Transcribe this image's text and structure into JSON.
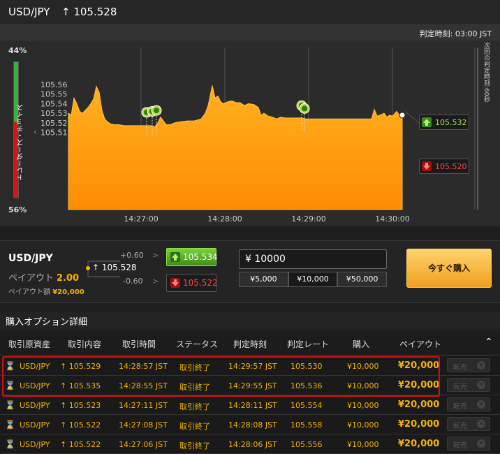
{
  "header": {
    "pair": "USD/JPY",
    "rate": "↑ 105.528"
  },
  "judge_bar": {
    "text": "判定時刻:  03:00 JST"
  },
  "sentiment": {
    "top_pct": "44%",
    "bottom_pct": "56%",
    "label": "トレーダーズ・チョイス",
    "up_fraction": 0.44
  },
  "next_judge": {
    "text": "次回の判定時刻:60秒"
  },
  "chart_data": {
    "type": "area",
    "y_ticks": [
      "105.56",
      "105.55",
      "105.54",
      "105.53",
      "105.52",
      "105.51"
    ],
    "ylim": [
      105.505,
      105.565
    ],
    "x_ticks": [
      "14:27:00",
      "14:28:00",
      "14:29:00",
      "14:30:00"
    ],
    "colors": {
      "fill_top": "#ffb020",
      "fill_bottom": "#ff8c00",
      "line": "#ffc040"
    },
    "points": [
      [
        0,
        105.53
      ],
      [
        4,
        105.528
      ],
      [
        8,
        105.546
      ],
      [
        12,
        105.54
      ],
      [
        16,
        105.532
      ],
      [
        20,
        105.53
      ],
      [
        24,
        105.533
      ],
      [
        28,
        105.536
      ],
      [
        32,
        105.54
      ],
      [
        36,
        105.545
      ],
      [
        40,
        105.558
      ],
      [
        44,
        105.552
      ],
      [
        48,
        105.533
      ],
      [
        52,
        105.524
      ],
      [
        56,
        105.521
      ],
      [
        60,
        105.519
      ],
      [
        66,
        105.518
      ],
      [
        72,
        105.518
      ],
      [
        80,
        105.517
      ],
      [
        90,
        105.517
      ],
      [
        100,
        105.517
      ],
      [
        110,
        105.517
      ],
      [
        118,
        105.517
      ],
      [
        124,
        105.516
      ],
      [
        128,
        105.52
      ],
      [
        132,
        105.526
      ],
      [
        136,
        105.522
      ],
      [
        140,
        105.518
      ],
      [
        146,
        105.518
      ],
      [
        152,
        105.52
      ],
      [
        160,
        105.521
      ],
      [
        170,
        105.522
      ],
      [
        180,
        105.522
      ],
      [
        190,
        105.524
      ],
      [
        196,
        105.53
      ],
      [
        200,
        105.538
      ],
      [
        204,
        105.552
      ],
      [
        206,
        105.559
      ],
      [
        210,
        105.546
      ],
      [
        214,
        105.548
      ],
      [
        218,
        105.542
      ],
      [
        222,
        105.54
      ],
      [
        228,
        105.542
      ],
      [
        234,
        105.543
      ],
      [
        240,
        105.541
      ],
      [
        246,
        105.541
      ],
      [
        252,
        105.538
      ],
      [
        258,
        105.54
      ],
      [
        266,
        105.539
      ],
      [
        272,
        105.536
      ],
      [
        276,
        105.528
      ],
      [
        280,
        105.53
      ],
      [
        286,
        105.527
      ],
      [
        292,
        105.526
      ],
      [
        298,
        105.524
      ],
      [
        304,
        105.526
      ],
      [
        310,
        105.525
      ],
      [
        318,
        105.525
      ],
      [
        326,
        105.525
      ],
      [
        334,
        105.525
      ],
      [
        340,
        105.524
      ],
      [
        348,
        105.524
      ],
      [
        356,
        105.524
      ],
      [
        364,
        105.524
      ],
      [
        372,
        105.524
      ],
      [
        380,
        105.524
      ],
      [
        388,
        105.524
      ],
      [
        394,
        105.524
      ],
      [
        400,
        105.524
      ],
      [
        406,
        105.524
      ],
      [
        412,
        105.524
      ],
      [
        418,
        105.524
      ],
      [
        424,
        105.524
      ],
      [
        430,
        105.524
      ],
      [
        434,
        105.524
      ],
      [
        438,
        105.534
      ],
      [
        442,
        105.527
      ],
      [
        446,
        105.528
      ],
      [
        452,
        105.53
      ],
      [
        456,
        105.526
      ],
      [
        460,
        105.528
      ],
      [
        464,
        105.527
      ],
      [
        470,
        105.532
      ],
      [
        474,
        105.528
      ],
      [
        478,
        105.528
      ]
    ],
    "markers": [
      [
        112,
        105.528
      ],
      [
        120,
        105.529
      ],
      [
        126,
        105.53
      ],
      [
        334,
        105.535
      ],
      [
        338,
        105.532
      ]
    ],
    "current": [
      478,
      105.528
    ]
  },
  "tags": {
    "up": "105.532",
    "down": "105.520"
  },
  "buy": {
    "pair": "USD/JPY",
    "payout_label": "ペイアウト",
    "payout_value": "2.00",
    "amount_label": "ペイアウト額",
    "amount_value": "¥20,000",
    "rate": "105.528",
    "plus": "+0.60",
    "minus": "-0.60",
    "gt": ">",
    "up_price": "105.534",
    "down_price": "105.522",
    "amount": "¥ 10000",
    "quick": [
      "¥5,000",
      "¥10,000",
      "¥50,000"
    ],
    "buy_now": "今すぐ購入"
  },
  "details": {
    "title": "購入オプション詳細",
    "headers": [
      "取引原資産",
      "取引内容",
      "取引時間",
      "ステータス",
      "判定時刻",
      "判定レート",
      "購入",
      "ペイアウト"
    ],
    "rows": [
      {
        "pair": "USD/JPY",
        "dir": "105.529",
        "time": "14:28:57 JST",
        "status": "取引終了",
        "judge": "14:29:57 JST",
        "rate": "105.530",
        "buy": "¥10,000",
        "payout": "¥20,000",
        "resell": "転売"
      },
      {
        "pair": "USD/JPY",
        "dir": "105.535",
        "time": "14:28:55 JST",
        "status": "取引終了",
        "judge": "14:29:55 JST",
        "rate": "105.536",
        "buy": "¥10,000",
        "payout": "¥20,000",
        "resell": "転売"
      },
      {
        "pair": "USD/JPY",
        "dir": "105.523",
        "time": "14:27:11 JST",
        "status": "取引終了",
        "judge": "14:28:11 JST",
        "rate": "105.554",
        "buy": "¥10,000",
        "payout": "¥20,000",
        "resell": "転売"
      },
      {
        "pair": "USD/JPY",
        "dir": "105.522",
        "time": "14:27:08 JST",
        "status": "取引終了",
        "judge": "14:28:08 JST",
        "rate": "105.558",
        "buy": "¥10,000",
        "payout": "¥20,000",
        "resell": "転売"
      },
      {
        "pair": "USD/JPY",
        "dir": "105.522",
        "time": "14:27:06 JST",
        "status": "取引終了",
        "judge": "14:28:06 JST",
        "rate": "105.556",
        "buy": "¥10,000",
        "payout": "¥20,000",
        "resell": "転売"
      }
    ]
  }
}
